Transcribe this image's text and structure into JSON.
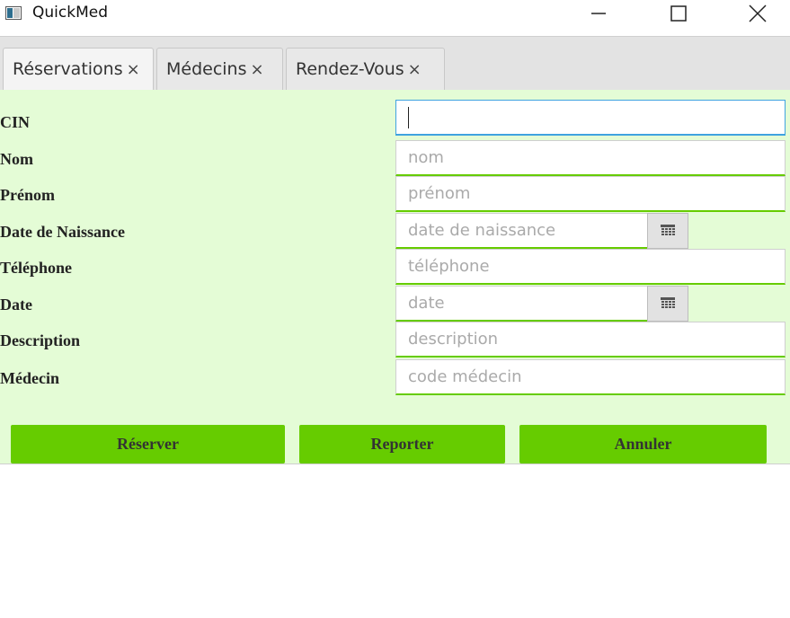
{
  "window": {
    "title": "QuickMed",
    "minimize_icon": "minimize-icon",
    "maximize_icon": "maximize-icon",
    "close_icon": "close-icon"
  },
  "tabs": [
    {
      "label": "Réservations",
      "close": "×",
      "active": true
    },
    {
      "label": "Médecins",
      "close": "×",
      "active": false
    },
    {
      "label": "Rendez-Vous",
      "close": "×",
      "active": false
    }
  ],
  "form": {
    "cin": {
      "label": "CIN",
      "value": "",
      "placeholder": ""
    },
    "nom": {
      "label": "Nom",
      "placeholder": "nom"
    },
    "prenom": {
      "label": "Prénom",
      "placeholder": "prénom"
    },
    "date_naissance": {
      "label": "Date de Naissance",
      "placeholder": "date de naissance"
    },
    "telephone": {
      "label": "Téléphone",
      "placeholder": "téléphone"
    },
    "date": {
      "label": "Date",
      "placeholder": "date"
    },
    "description": {
      "label": "Description",
      "placeholder": "description"
    },
    "medecin": {
      "label": "Médecin",
      "placeholder": "code médecin"
    }
  },
  "actions": {
    "reserver": "Réserver",
    "reporter": "Reporter",
    "annuler": "Annuler"
  },
  "colors": {
    "form_background": "#e4fcd6",
    "accent_green": "#66cc00",
    "focus_blue": "#3fa3e0"
  }
}
